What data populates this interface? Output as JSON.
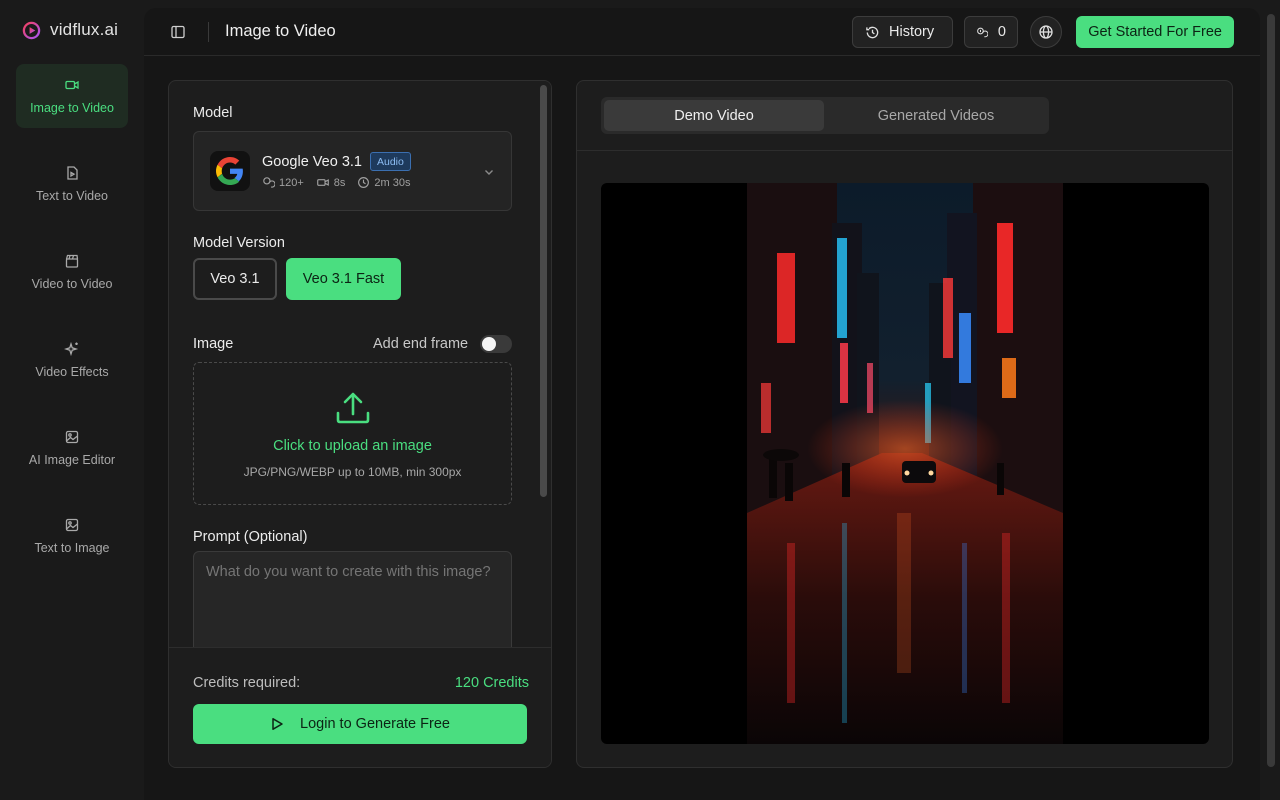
{
  "brand": {
    "name": "vidflux.ai"
  },
  "sidebar": {
    "items": [
      {
        "label": "Image to Video",
        "icon": "video-camera-icon",
        "active": true
      },
      {
        "label": "Text to Video",
        "icon": "document-play-icon",
        "active": false
      },
      {
        "label": "Video to Video",
        "icon": "clapperboard-icon",
        "active": false
      },
      {
        "label": "Video Effects",
        "icon": "sparkles-icon",
        "active": false
      },
      {
        "label": "AI Image Editor",
        "icon": "image-icon",
        "active": false
      },
      {
        "label": "Text to Image",
        "icon": "image-icon",
        "active": false
      }
    ]
  },
  "header": {
    "title": "Image to Video",
    "history_label": "History",
    "credits_count": "0",
    "cta_label": "Get Started For Free"
  },
  "form": {
    "model_label": "Model",
    "model": {
      "name": "Google Veo 3.1",
      "badge": "Audio",
      "credits": "120+",
      "duration": "8s",
      "time": "2m 30s"
    },
    "version_label": "Model Version",
    "versions": [
      {
        "label": "Veo 3.1",
        "selected": false
      },
      {
        "label": "Veo 3.1 Fast",
        "selected": true
      }
    ],
    "image_label": "Image",
    "end_frame_label": "Add end frame",
    "end_frame_on": false,
    "upload_text": "Click to upload an image",
    "upload_hint": "JPG/PNG/WEBP up to 10MB, min 300px",
    "prompt_label": "Prompt (Optional)",
    "prompt_placeholder": "What do you want to create with this image?",
    "prompt_value": ""
  },
  "footer": {
    "credits_label": "Credits required:",
    "credits_value": "120 Credits",
    "login_label": "Login to Generate Free"
  },
  "preview": {
    "tabs": [
      {
        "label": "Demo Video",
        "active": true
      },
      {
        "label": "Generated Videos",
        "active": false
      }
    ]
  },
  "colors": {
    "accent": "#4ade80",
    "background": "#1a1a1a",
    "panel": "#1d1d1d",
    "badge_blue": "#3b6fb0"
  }
}
